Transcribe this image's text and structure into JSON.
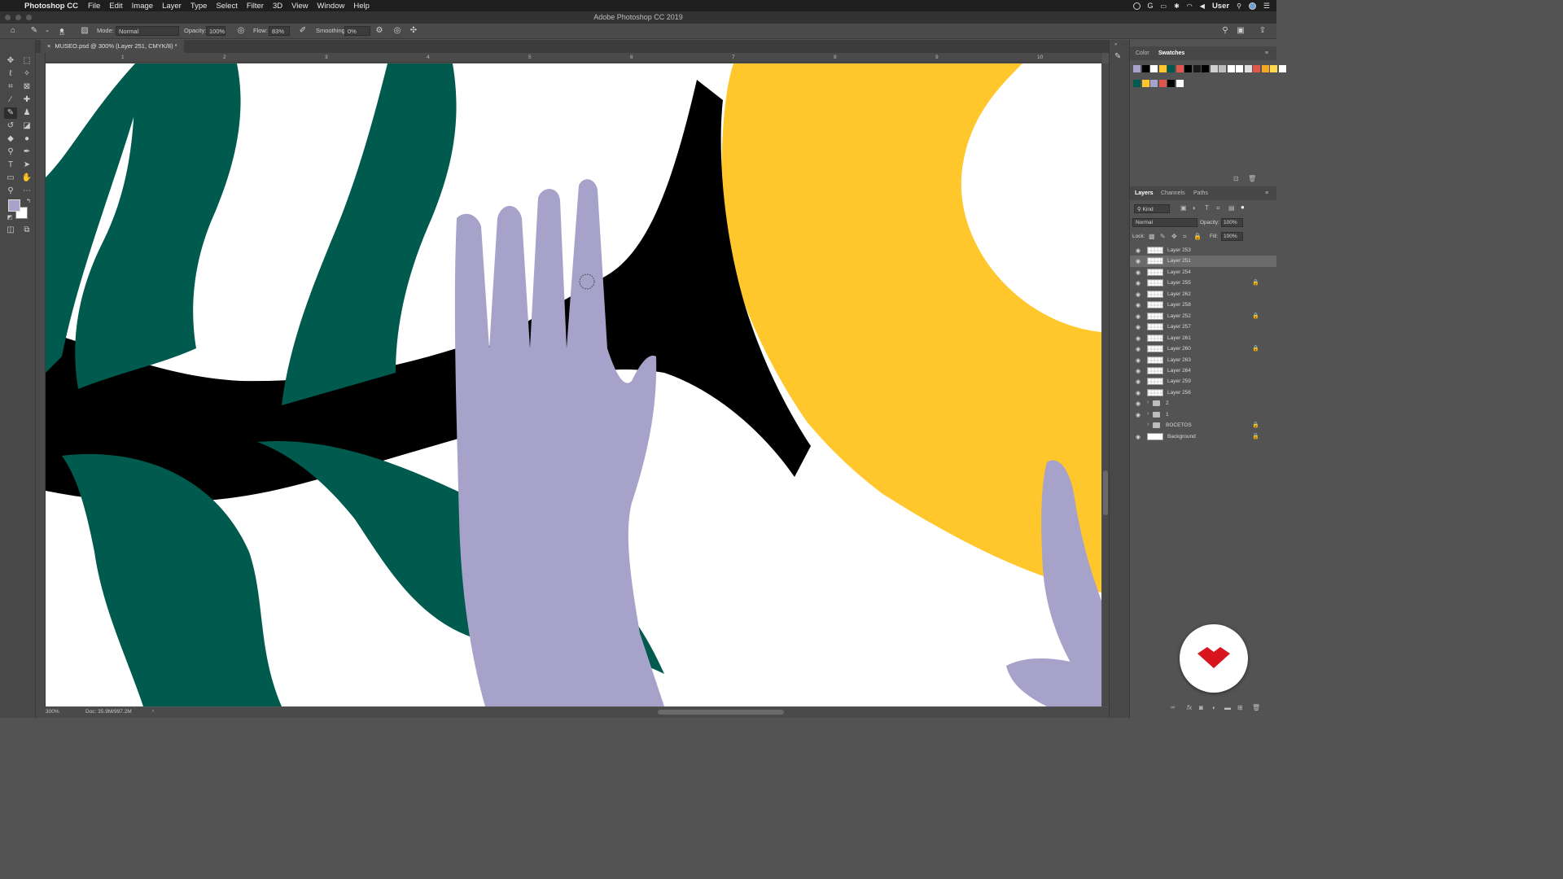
{
  "menubar": {
    "app_name": "Photoshop CC",
    "items": [
      "File",
      "Edit",
      "Image",
      "Layer",
      "Type",
      "Select",
      "Filter",
      "3D",
      "View",
      "Window",
      "Help"
    ],
    "user": "User"
  },
  "window": {
    "title": "Adobe Photoshop CC 2019"
  },
  "options": {
    "brush_size": "15",
    "mode_label": "Mode:",
    "mode_value": "Normal",
    "opacity_label": "Opacity:",
    "opacity_value": "100%",
    "flow_label": "Flow:",
    "flow_value": "83%",
    "smoothing_label": "Smoothing:",
    "smoothing_value": "0%"
  },
  "document": {
    "tab_title": "MUSEO.psd @ 300% (Layer 251, CMYK/8) *"
  },
  "ruler": {
    "ticks": [
      "1",
      "2",
      "3",
      "4",
      "5",
      "6",
      "7",
      "8",
      "9",
      "10"
    ]
  },
  "status": {
    "zoom": "300%",
    "doc_size": "Doc: 35.9M/997.2M"
  },
  "color_panel": {
    "tabs": [
      "Color",
      "Swatches"
    ],
    "active_tab": "Swatches",
    "swatches_row1": [
      "#a7a2c9",
      "#000000",
      "#ffffff",
      "#ffc72c",
      "#005a4e",
      "#e0564c",
      "#000000",
      "#1a1a1a",
      "#000000",
      "#cfcfcf",
      "#bdbdbd",
      "#ffffff",
      "#ffffff",
      "#e0e0e0",
      "#e0564c",
      "#f5a623",
      "#ffd84d",
      "#ffffff"
    ],
    "swatches_row2": [
      "#005a4e",
      "#ffc72c",
      "#a7a2c9",
      "#e0564c",
      "#000000",
      "#ffffff"
    ]
  },
  "layers_panel": {
    "tabs": [
      "Layers",
      "Channels",
      "Paths"
    ],
    "active_tab": "Layers",
    "filter_kind": "Kind",
    "blend_mode": "Normal",
    "opacity_label": "Opacity:",
    "opacity_value": "100%",
    "lock_label": "Lock:",
    "fill_label": "Fill:",
    "fill_value": "100%",
    "layers": [
      {
        "name": "Layer 253",
        "locked": false,
        "selected": false,
        "type": "pixel",
        "visible": true
      },
      {
        "name": "Layer 251",
        "locked": false,
        "selected": true,
        "type": "pixel",
        "visible": true
      },
      {
        "name": "Layer 254",
        "locked": false,
        "selected": false,
        "type": "pixel",
        "visible": true
      },
      {
        "name": "Layer 255",
        "locked": true,
        "selected": false,
        "type": "pixel",
        "visible": true
      },
      {
        "name": "Layer 262",
        "locked": false,
        "selected": false,
        "type": "pixel",
        "visible": true
      },
      {
        "name": "Layer 258",
        "locked": false,
        "selected": false,
        "type": "pixel",
        "visible": true
      },
      {
        "name": "Layer 252",
        "locked": true,
        "selected": false,
        "type": "pixel",
        "visible": true
      },
      {
        "name": "Layer 257",
        "locked": false,
        "selected": false,
        "type": "pixel",
        "visible": true
      },
      {
        "name": "Layer 261",
        "locked": false,
        "selected": false,
        "type": "pixel",
        "visible": true
      },
      {
        "name": "Layer 260",
        "locked": true,
        "selected": false,
        "type": "pixel",
        "visible": true
      },
      {
        "name": "Layer 263",
        "locked": false,
        "selected": false,
        "type": "pixel",
        "visible": true
      },
      {
        "name": "Layer 264",
        "locked": false,
        "selected": false,
        "type": "pixel",
        "visible": true
      },
      {
        "name": "Layer 259",
        "locked": false,
        "selected": false,
        "type": "pixel",
        "visible": true
      },
      {
        "name": "Layer 256",
        "locked": false,
        "selected": false,
        "type": "pixel",
        "visible": true
      },
      {
        "name": "2",
        "locked": false,
        "selected": false,
        "type": "group",
        "visible": true
      },
      {
        "name": "1",
        "locked": false,
        "selected": false,
        "type": "group",
        "visible": true
      },
      {
        "name": "BOCETOS",
        "locked": true,
        "selected": false,
        "type": "group",
        "visible": false
      },
      {
        "name": "Background",
        "locked": true,
        "selected": false,
        "type": "background",
        "visible": true
      }
    ]
  },
  "colors": {
    "teal": "#005a4e",
    "yellow": "#ffc72c",
    "lavender": "#a7a2c9",
    "black": "#000000",
    "badge_red": "#d8141c"
  }
}
